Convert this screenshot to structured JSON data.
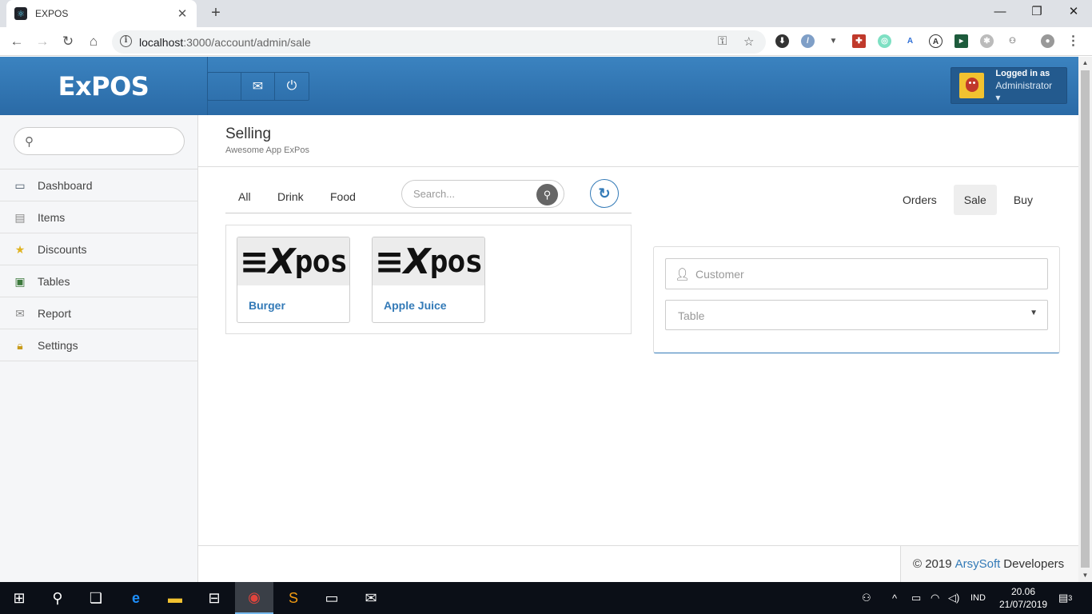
{
  "browser": {
    "tab_title": "EXPOS",
    "tab_close": "✕",
    "new_tab": "+",
    "url_host": "localhost",
    "url_rest": ":3000/account/admin/sale",
    "window_minimize": "—",
    "window_restore": "❐",
    "window_close": "✕"
  },
  "header": {
    "brand": "ExPOS",
    "logged_in_label": "Logged in as",
    "user_role": "Administrator ▾"
  },
  "sidebar": {
    "search_placeholder": "",
    "items": [
      {
        "label": "Dashboard",
        "icon": "monitor-icon"
      },
      {
        "label": "Items",
        "icon": "items-icon"
      },
      {
        "label": "Discounts",
        "icon": "star-icon"
      },
      {
        "label": "Tables",
        "icon": "tables-icon"
      },
      {
        "label": "Report",
        "icon": "report-icon"
      },
      {
        "label": "Settings",
        "icon": "lock-icon"
      }
    ]
  },
  "page": {
    "title": "Selling",
    "subtitle": "Awesome App ExPos"
  },
  "filters": {
    "tabs": [
      "All",
      "Drink",
      "Food"
    ],
    "search_placeholder": "Search..."
  },
  "products": [
    {
      "name": "Burger",
      "logo_text": "pos"
    },
    {
      "name": "Apple Juice",
      "logo_text": "pos"
    }
  ],
  "order": {
    "tabs": [
      "Orders",
      "Sale",
      "Buy"
    ],
    "active_tab": "Sale",
    "customer_placeholder": "Customer",
    "table_placeholder": "Table"
  },
  "footer": {
    "copyright": "© 2019",
    "company": "ArsySoft",
    "suffix": "Developers"
  },
  "taskbar": {
    "language": "IND",
    "time": "20.06",
    "date": "21/07/2019",
    "notifications": "3"
  },
  "colors": {
    "header_blue": "#3b83c0",
    "link_blue": "#337ab7"
  }
}
